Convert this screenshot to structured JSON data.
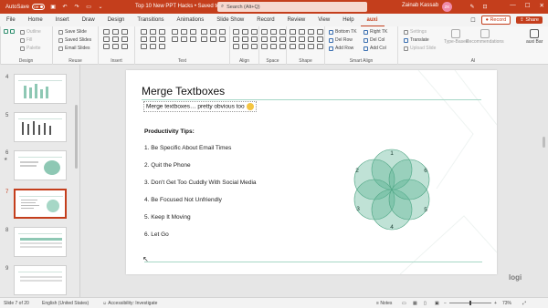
{
  "titlebar": {
    "autosave_label": "AutoSave",
    "autosave_state": "Off",
    "doc_title": "Top 10 New PPT Hacks • Saved to this PC ⌄",
    "search_placeholder": "Search (Alt+Q)",
    "user_name": "Zainab Kassab",
    "user_initials": "ZK",
    "minimize": "—",
    "maximize": "☐",
    "close": "✕"
  },
  "menu": {
    "tabs": [
      "File",
      "Home",
      "Insert",
      "Draw",
      "Design",
      "Transitions",
      "Animations",
      "Slide Show",
      "Record",
      "Review",
      "View",
      "Help",
      "auxi"
    ],
    "active_index": 12,
    "record_label": "Record",
    "share_label": "Share"
  },
  "ribbon": {
    "design": {
      "label": "Design",
      "items": [
        "Outline",
        "Fill",
        "Palette"
      ]
    },
    "reuse": {
      "label": "Reuse",
      "items": [
        "Save Slide",
        "Saved Slides",
        "Email Slides"
      ]
    },
    "insert": {
      "label": "Insert"
    },
    "text": {
      "label": "Text"
    },
    "align": {
      "label": "Align"
    },
    "space": {
      "label": "Space"
    },
    "shape": {
      "label": "Shape"
    },
    "smart_align": {
      "label": "Smart Align",
      "items": [
        "Bottom TK",
        "Del Row",
        "Add Row",
        "Right TK",
        "Del Col",
        "Add Col"
      ]
    },
    "ai": {
      "label": "AI",
      "items": [
        "Settings",
        "Translate",
        "Upload Slide"
      ],
      "buttons": [
        "Type-Based",
        "Recommendations",
        "auxi Bar"
      ]
    }
  },
  "thumbnails": {
    "numbers": [
      "4",
      "5",
      "6",
      "7",
      "8",
      "9"
    ],
    "selected": "7",
    "star": "★"
  },
  "slide": {
    "title": "Merge Textboxes",
    "subtitle": "Merge textboxes… pretty obvious too",
    "tips_title": "Productivity Tips:",
    "tips": [
      "1. Be Specific About Email Times",
      "2. Quit the Phone",
      "3. Don't Get Too Cuddly With Social Media",
      "4. Be Focused Not Unfriendly",
      "5. Keep It Moving",
      "6. Let Go"
    ],
    "petal_numbers": [
      "1",
      "2",
      "3",
      "4",
      "5",
      "6"
    ],
    "petal_color": "#5ab393"
  },
  "logo": "logi",
  "statusbar": {
    "slide_info": "Slide 7 of 20",
    "language": "English (United States)",
    "accessibility": "Accessibility: Investigate",
    "notes": "Notes",
    "zoom": "73%"
  },
  "colors": {
    "accent": "#c43e1c",
    "slide_accent": "#a6d7c6"
  }
}
